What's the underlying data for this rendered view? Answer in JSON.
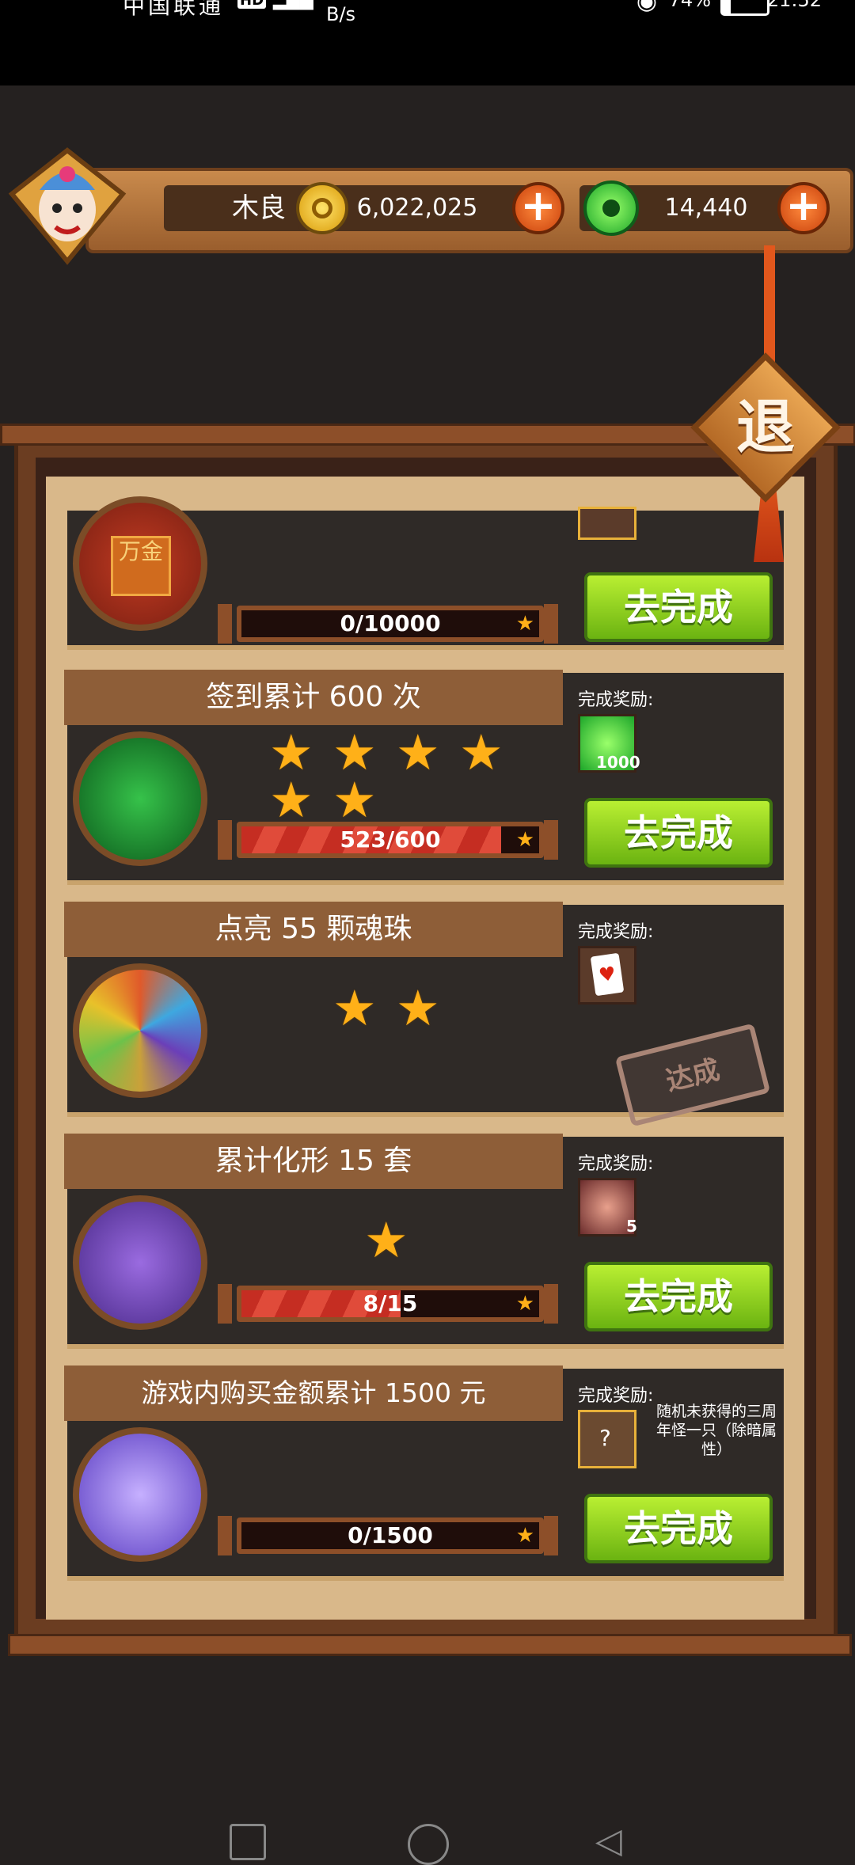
{
  "status_bar": {
    "carrier": "中国联通",
    "hd": "HD",
    "speed": "B/s",
    "battery": "74%",
    "time": "21:52"
  },
  "header": {
    "player_name": "木良",
    "coins": "6,022,025",
    "gems": "14,440"
  },
  "exit_label": "退",
  "reward_label": "完成奖励:",
  "go_label": "去完成",
  "achieved_label": "达成",
  "tasks": [
    {
      "progress_text": "0/10000",
      "progress": 0,
      "icon_text": "万金"
    },
    {
      "title": "签到累计 600 次",
      "stars": 6,
      "reward_count": "1000",
      "progress_text": "523/600",
      "progress": 0.8717
    },
    {
      "title": "点亮 55 颗魂珠",
      "stars": 2
    },
    {
      "title": "累计化形 15 套",
      "stars": 1,
      "reward_count": "5",
      "progress_text": "8/15",
      "progress": 0.5333
    },
    {
      "title": "游戏内购买金额累计 1500 元",
      "reward_desc": "随机未获得的三周年怪一只（除暗属性）",
      "progress_text": "0/1500",
      "progress": 0
    }
  ]
}
